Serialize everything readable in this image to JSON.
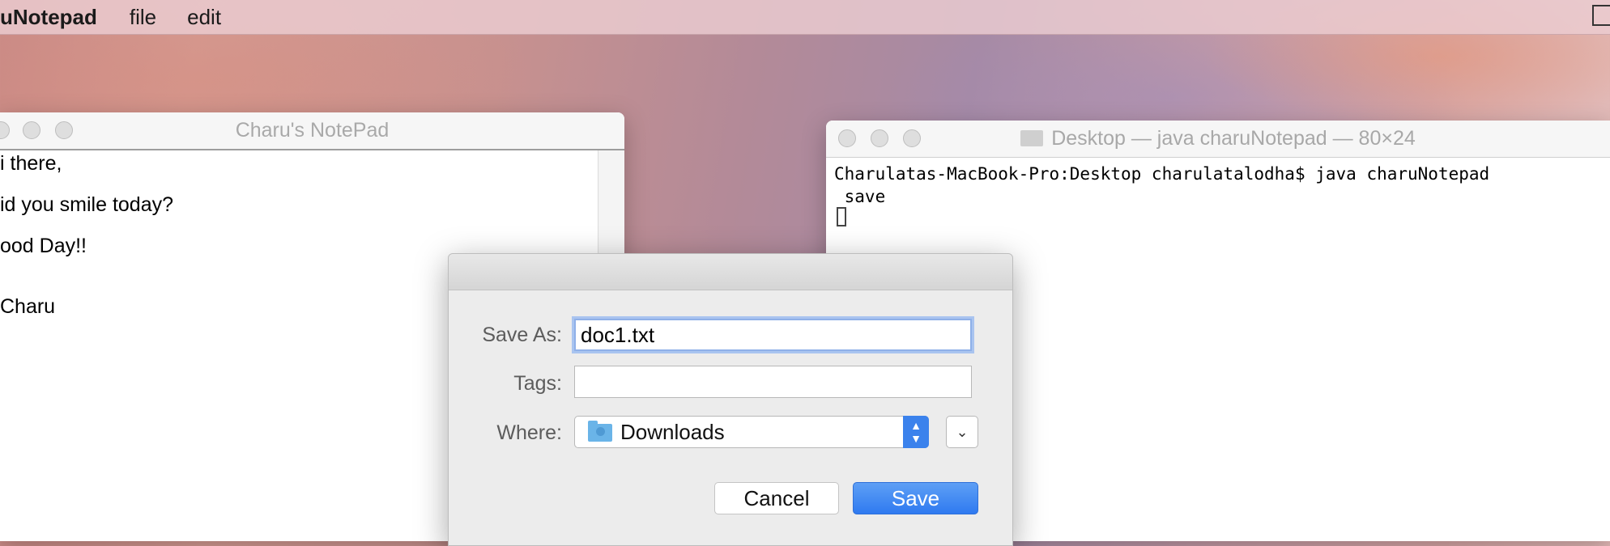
{
  "menubar": {
    "app_name": "uNotepad",
    "menus": [
      "file",
      "edit"
    ]
  },
  "notepad": {
    "title": "Charu's NotePad",
    "lines": [
      "i there,",
      "id you smile today?",
      "ood Day!!",
      "Charu"
    ]
  },
  "terminal": {
    "title": "Desktop — java charuNotepad — 80×24",
    "line1": "Charulatas-MacBook-Pro:Desktop charulatalodha$ java charuNotepad",
    "line2": " save"
  },
  "save_dialog": {
    "save_as_label": "Save As:",
    "save_as_value": "doc1.txt",
    "tags_label": "Tags:",
    "tags_value": "",
    "where_label": "Where:",
    "where_value": "Downloads",
    "cancel_label": "Cancel",
    "save_label": "Save"
  },
  "colors": {
    "accent": "#3b82ec",
    "focus_ring": "#a9c4f0"
  },
  "icons": [
    "traffic-light-icons",
    "folder-icon",
    "downloads-folder-icon",
    "stepper-icon",
    "chevron-down-icon"
  ]
}
